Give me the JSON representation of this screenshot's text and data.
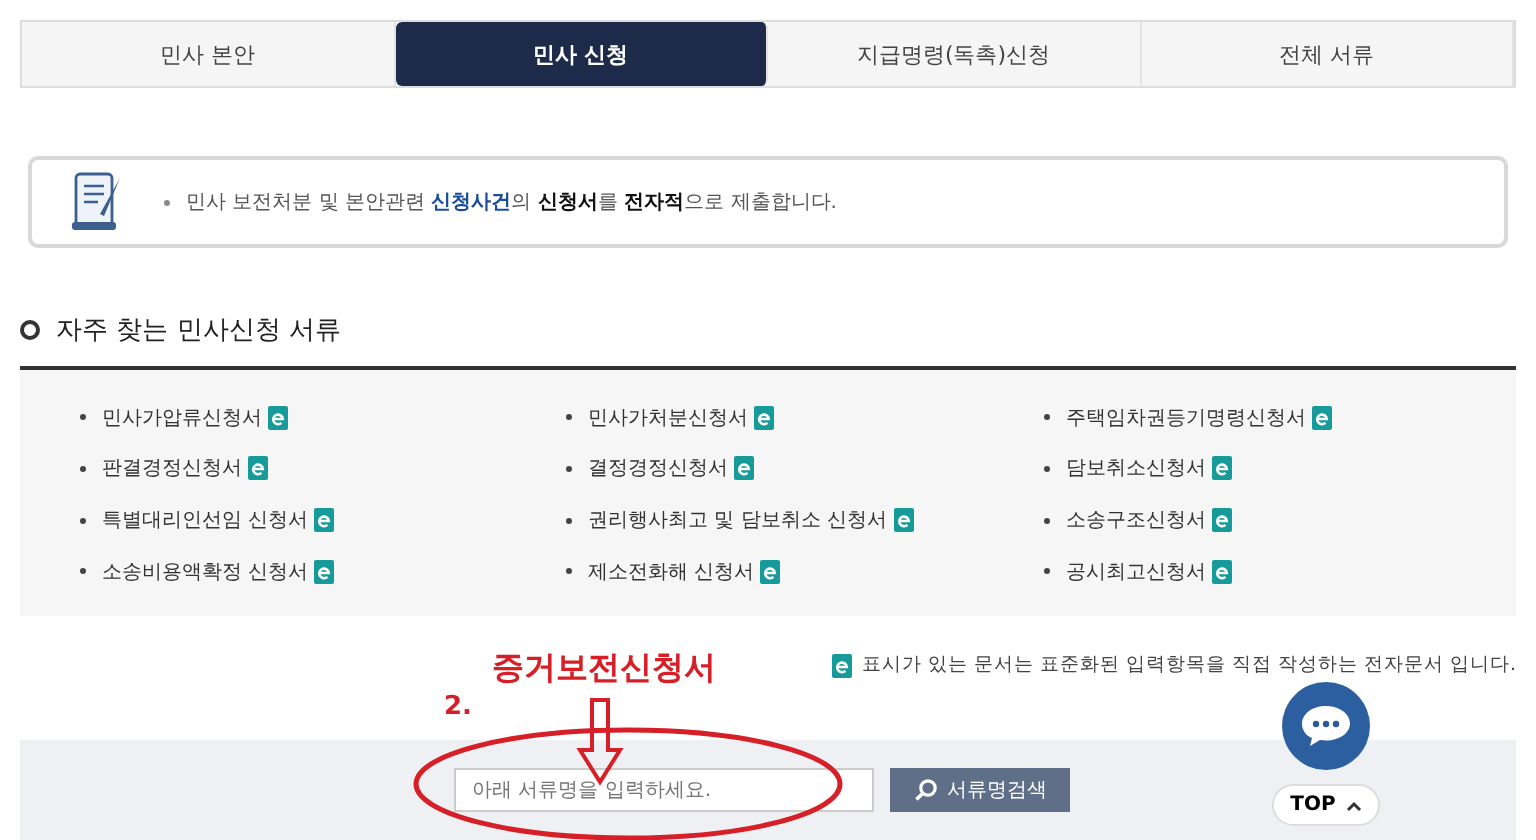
{
  "tabs": [
    {
      "label": "민사 본안",
      "selected": false
    },
    {
      "label": "민사 신청",
      "selected": true
    },
    {
      "label": "지급명령(독촉)신청",
      "selected": false
    },
    {
      "label": "전체 서류",
      "selected": false
    }
  ],
  "notice": {
    "text": "민사 보전처분 및 본안관련 **신청사건**의 **신청서**를 **전자적**으로 제출합니다."
  },
  "section": {
    "title": "자주 찾는 민사신청 서류"
  },
  "documents": [
    {
      "name": "민사가압류신청서",
      "e_form": true
    },
    {
      "name": "민사가처분신청서",
      "e_form": true
    },
    {
      "name": "주택임차권등기명령신청서",
      "e_form": true
    },
    {
      "name": "판결경정신청서",
      "e_form": true
    },
    {
      "name": "결정경정신청서",
      "e_form": true
    },
    {
      "name": "담보취소신청서",
      "e_form": true
    },
    {
      "name": "특별대리인선임 신청서",
      "e_form": true
    },
    {
      "name": "권리행사최고 및 담보취소 신청서",
      "e_form": true
    },
    {
      "name": "소송구조신청서",
      "e_form": true
    },
    {
      "name": "소송비용액확정 신청서",
      "e_form": true
    },
    {
      "name": "제소전화해 신청서",
      "e_form": true
    },
    {
      "name": "공시최고신청서",
      "e_form": true
    }
  ],
  "legend": "표시가 있는 문서는 표준화된 입력항목을 직접 작성하는 전자문서 입니다.",
  "search": {
    "placeholder": "아래 서류명을 입력하세요.",
    "button": "서류명검색"
  },
  "top_button": "TOP",
  "annotations": {
    "title": "증거보전신청서",
    "step": "2."
  }
}
